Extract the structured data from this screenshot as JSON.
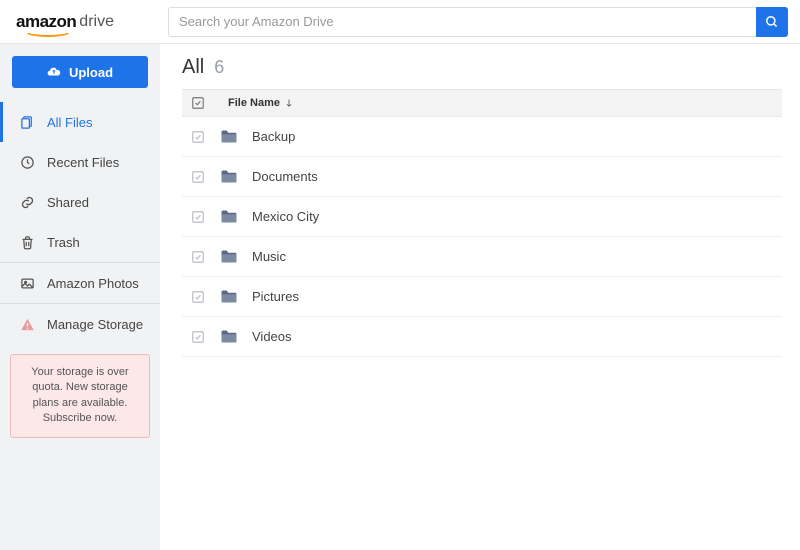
{
  "header": {
    "logo_primary": "amazon",
    "logo_secondary": "drive",
    "search_placeholder": "Search your Amazon Drive"
  },
  "sidebar": {
    "upload_label": "Upload",
    "items": [
      {
        "label": "All Files"
      },
      {
        "label": "Recent Files"
      },
      {
        "label": "Shared"
      },
      {
        "label": "Trash"
      },
      {
        "label": "Amazon Photos"
      },
      {
        "label": "Manage Storage"
      }
    ],
    "storage_warning": "Your storage is over quota. New storage plans are available. Subscribe now."
  },
  "main": {
    "title": "All",
    "count": "6",
    "columns": {
      "file_name": "File Name"
    },
    "rows": [
      {
        "name": "Backup"
      },
      {
        "name": "Documents"
      },
      {
        "name": "Mexico City"
      },
      {
        "name": "Music"
      },
      {
        "name": "Pictures"
      },
      {
        "name": "Videos"
      }
    ]
  }
}
